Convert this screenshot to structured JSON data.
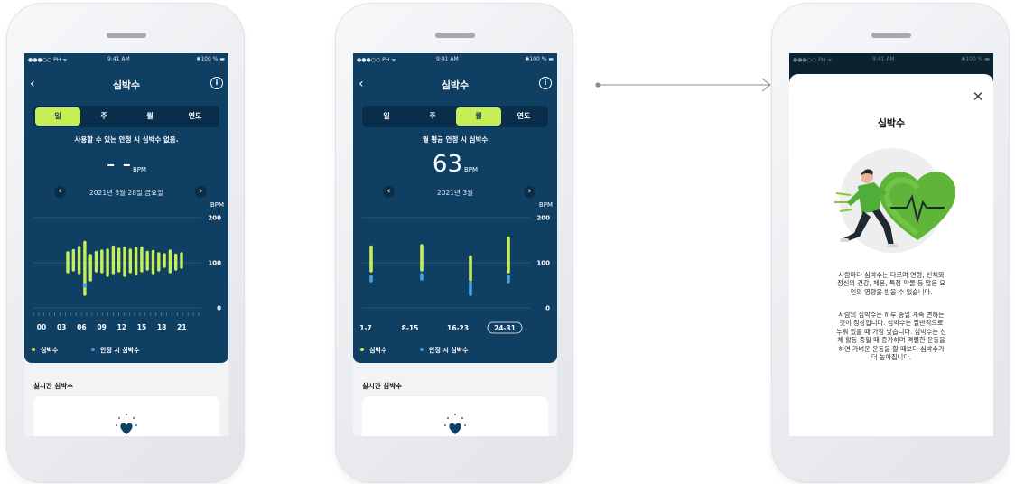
{
  "status": {
    "carrier": "●●●○○ PH ᯤ",
    "time": "9:41 AM",
    "battery": "✱100 % ▬"
  },
  "nav": {
    "title": "심박수"
  },
  "tabs": [
    "일",
    "주",
    "월",
    "연도"
  ],
  "colors": {
    "app_bg": "#0f3f63",
    "accent": "#c5ee57",
    "resting": "#4a9fe0"
  },
  "legend": {
    "heart_rate": "심박수",
    "resting": "안정 시 심박수"
  },
  "live": {
    "title": "실시간 심박수"
  },
  "phone1": {
    "active_tab": "일",
    "caption": "사용할 수 있는 안정 시 심박수 없음.",
    "value": "- -",
    "unit": "BPM",
    "date": "2021년 3월 28일 금요일"
  },
  "phone2": {
    "active_tab": "월",
    "caption": "월 평균 안정 시 심박수",
    "value": "63",
    "unit": "BPM",
    "date": "2021년 3월"
  },
  "chart_data": [
    {
      "type": "bar",
      "ylabel": "BPM",
      "ylim": [
        0,
        200
      ],
      "yticks": [
        200,
        100,
        0
      ],
      "xticks": [
        "00",
        "03",
        "06",
        "09",
        "12",
        "15",
        "18",
        "21"
      ],
      "series": [
        {
          "name": "심박수",
          "values": [
            [
              80,
              122
            ],
            [
              84,
              127
            ],
            [
              78,
              134
            ],
            [
              30,
              145
            ],
            [
              62,
              116
            ],
            [
              82,
              123
            ],
            [
              80,
              126
            ],
            [
              72,
              128
            ],
            [
              78,
              135
            ],
            [
              82,
              130
            ],
            [
              72,
              133
            ],
            [
              80,
              128
            ],
            [
              75,
              132
            ],
            [
              82,
              133
            ],
            [
              86,
              123
            ],
            [
              78,
              125
            ],
            [
              84,
              120
            ],
            [
              92,
              118
            ],
            [
              80,
              126
            ],
            [
              86,
              117
            ],
            [
              90,
              120
            ]
          ]
        },
        {
          "name": "안정 시 심박수",
          "values": [
            {
              "index": 3,
              "value": 50
            }
          ]
        }
      ]
    },
    {
      "type": "bar",
      "ylabel": "BPM",
      "ylim": [
        0,
        200
      ],
      "yticks": [
        200,
        100,
        0
      ],
      "categories": [
        "1-7",
        "8-15",
        "16-23",
        "24-31"
      ],
      "selected_category": "24-31",
      "series": [
        {
          "name": "심박수",
          "values": [
            [
              82,
              135
            ],
            [
              84,
              138
            ],
            [
              62,
              113
            ],
            [
              80,
              155
            ]
          ]
        },
        {
          "name": "안정 시 심박수",
          "values": [
            [
              60,
              70
            ],
            [
              64,
              74
            ],
            [
              30,
              56
            ],
            [
              58,
              70
            ]
          ]
        }
      ]
    }
  ],
  "info": {
    "title": "심박수",
    "paragraph1": [
      "사람마다 심박수는 다르며 연령, 신체와",
      "정신의 건강, 체온, 특정 약물 등 많은 요",
      "인의 영향을 받을 수 있습니다."
    ],
    "paragraph2": [
      "사람의 심박수는 하루 종일 계속 변하는",
      "것이 정상입니다. 심박수는 일반적으로",
      "누워 있을 때 가장 낮습니다. 심박수는 신",
      "체 활동 중일 때 증가하며 격렬한 운동을",
      "하면 가벼운 운동을 할 때보다 심박수가",
      "더 높아집니다."
    ]
  }
}
